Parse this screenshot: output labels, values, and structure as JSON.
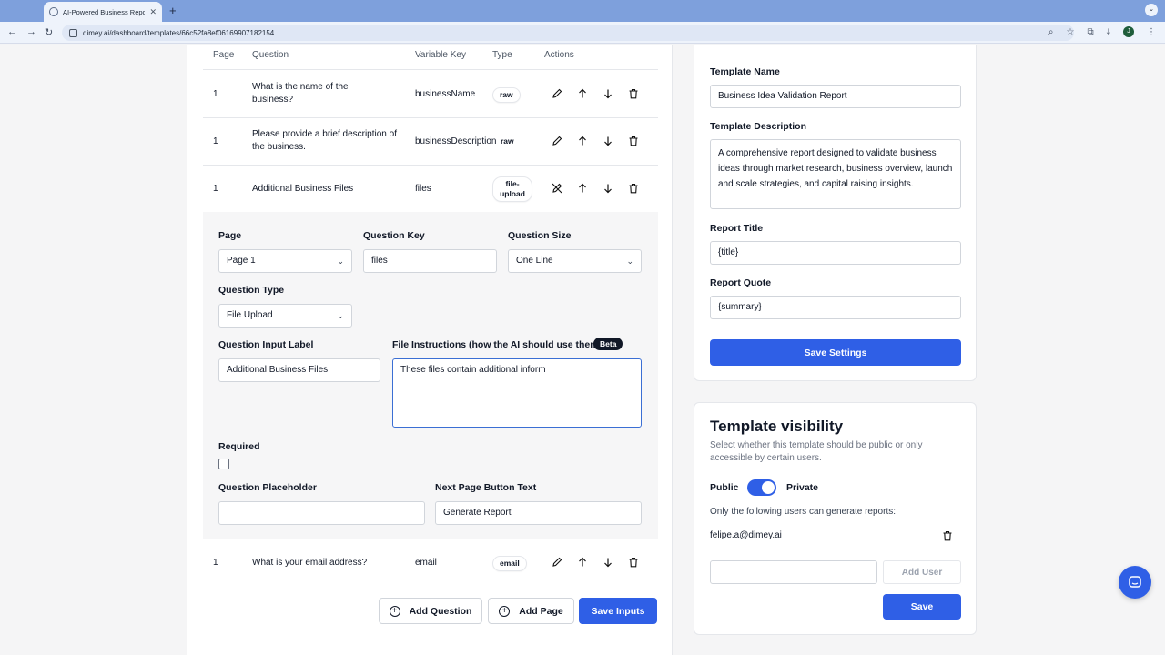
{
  "browser": {
    "tab_title": "AI-Powered Business Reports",
    "url": "dimey.ai/dashboard/templates/66c52fa8ef06169907182154",
    "profile_initial": "J"
  },
  "table": {
    "headers": [
      "Page",
      "Question",
      "Variable Key",
      "Type",
      "Actions"
    ],
    "rows": [
      {
        "page": "1",
        "question": "What is the name of the business?",
        "key": "businessName",
        "type": "raw"
      },
      {
        "page": "1",
        "question": "Please provide a brief description of the business.",
        "key": "businessDescription",
        "type": "raw"
      },
      {
        "page": "1",
        "question": "Additional Business Files",
        "key": "files",
        "type": "file-upload"
      },
      {
        "page": "1",
        "question": "What is your email address?",
        "key": "email",
        "type": "email"
      }
    ]
  },
  "editor": {
    "page_label": "Page",
    "page_value": "Page 1",
    "key_label": "Question Key",
    "key_value": "files",
    "size_label": "Question Size",
    "size_value": "One Line",
    "type_label": "Question Type",
    "type_value": "File Upload",
    "input_label_label": "Question Input Label",
    "input_label_value": "Additional Business Files",
    "instructions_label": "File Instructions (how the AI should use them)",
    "beta": "Beta",
    "instructions_value": "These files contain additional inform",
    "required_label": "Required",
    "placeholder_label": "Question Placeholder",
    "placeholder_value": "",
    "next_label": "Next Page Button Text",
    "next_value": "Generate Report"
  },
  "actions": {
    "add_question": "Add Question",
    "add_page": "Add Page",
    "save_inputs": "Save Inputs"
  },
  "settings": {
    "name_label": "Template Name",
    "name_value": "Business Idea Validation Report",
    "desc_label": "Template Description",
    "desc_value": "A comprehensive report designed to validate business ideas through market research, business overview, launch and scale strategies, and capital raising insights.",
    "report_title_label": "Report Title",
    "report_title_value": "{title}",
    "report_quote_label": "Report Quote",
    "report_quote_value": "{summary}",
    "save": "Save Settings"
  },
  "visibility": {
    "title": "Template visibility",
    "desc": "Select whether this template should be public or only accessible by certain users.",
    "public": "Public",
    "private": "Private",
    "users_note": "Only the following users can generate reports:",
    "user": "felipe.a@dimey.ai",
    "add_user": "Add User",
    "save": "Save"
  },
  "colors": {
    "accent": "#2f5fe6"
  }
}
